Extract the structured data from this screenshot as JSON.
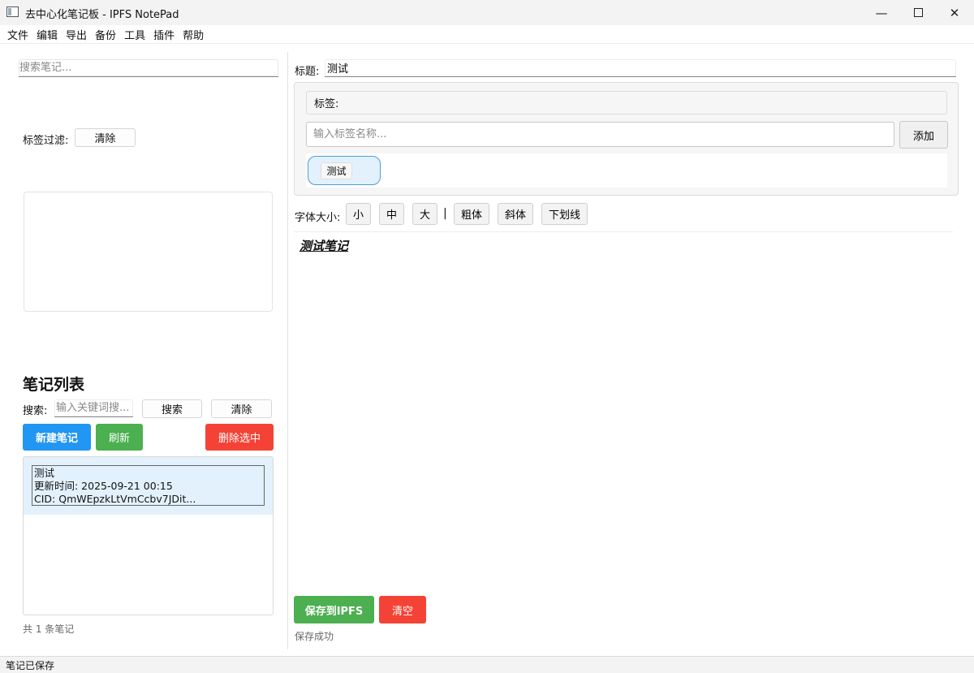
{
  "window": {
    "title": "去中心化笔记板 - IPFS NotePad",
    "minimize": "—",
    "close": "✕"
  },
  "menu": [
    "文件",
    "编辑",
    "导出",
    "备份",
    "工具",
    "插件",
    "帮助"
  ],
  "left": {
    "search_placeholder": "搜索笔记...",
    "tag_filter_label": "标签过滤:",
    "tag_filter_clear": "清除",
    "notes_heading": "笔记列表",
    "search_label": "搜索:",
    "keyword_placeholder": "输入关键词搜...",
    "search_button": "搜索",
    "clear_button": "清除",
    "new_note_button": "新建笔记",
    "refresh_button": "刷新",
    "delete_selected_button": "删除选中",
    "notes": [
      {
        "title": "测试",
        "updated": "更新时间: 2025-09-21 00:15",
        "cid": "CID: QmWEpzkLtVmCcbv7JDit..."
      }
    ],
    "note_count": "共 1 条笔记"
  },
  "right": {
    "title_label": "标题:",
    "title_value": "测试",
    "tags_header": "标签:",
    "tag_input_placeholder": "输入标签名称...",
    "add_tag_button": "添加",
    "tags": [
      "测试"
    ],
    "font_size_label": "字体大小:",
    "font_small": "小",
    "font_medium": "中",
    "font_large": "大",
    "separator": "|",
    "bold": "粗体",
    "italic": "斜体",
    "underline": "下划线",
    "editor_content": "测试笔记",
    "save_button": "保存到IPFS",
    "clear_button": "清空",
    "save_status": "保存成功"
  },
  "statusbar": {
    "text": "笔记已保存"
  }
}
